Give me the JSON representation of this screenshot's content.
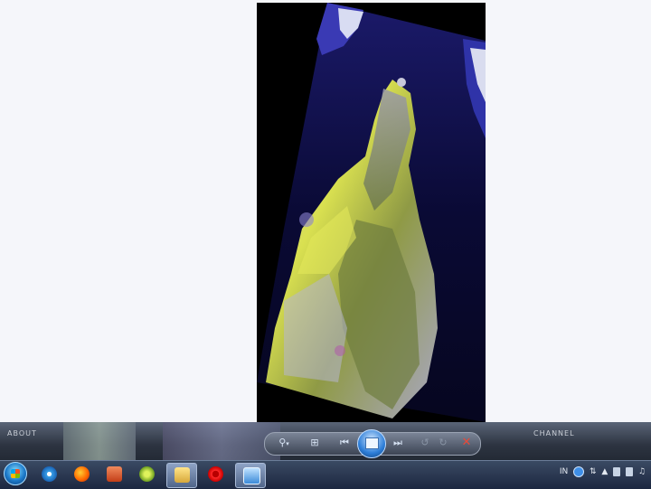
{
  "viewer": {
    "image_name": "satellite-image",
    "ghost_labels": [
      "ABOUT",
      "CHANNEL"
    ]
  },
  "controls": {
    "zoom_icon": "magnifier-icon",
    "fit_icon": "fit-window-icon",
    "prev_icon": "previous-icon",
    "slideshow_icon": "slideshow-icon",
    "next_icon": "next-icon",
    "rotate_ccw_icon": "rotate-left-icon",
    "rotate_cw_icon": "rotate-right-icon",
    "delete_icon": "delete-icon"
  },
  "taskbar": {
    "apps": [
      {
        "name": "internet-explorer",
        "active": false
      },
      {
        "name": "firefox",
        "active": false
      },
      {
        "name": "powerpoint",
        "active": false
      },
      {
        "name": "app-green",
        "active": false
      },
      {
        "name": "file-explorer",
        "active": true
      },
      {
        "name": "opera",
        "active": false
      },
      {
        "name": "photo-viewer",
        "active": true
      }
    ],
    "tray": {
      "language": "IN"
    }
  },
  "colors": {
    "accent": "#2d7ed8",
    "delete": "#e64a3a",
    "taskbar": "#1c2740"
  }
}
